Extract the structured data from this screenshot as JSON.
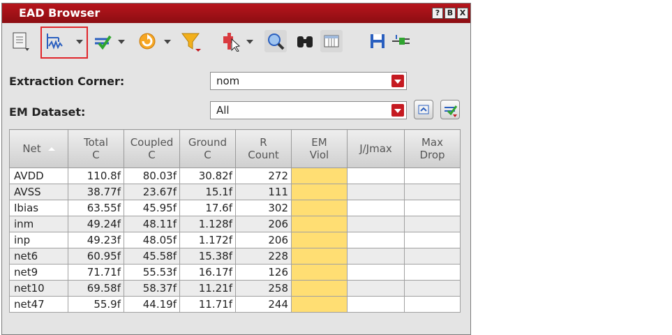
{
  "window": {
    "title": "EAD Browser",
    "title_buttons": [
      "?",
      "B",
      "X"
    ]
  },
  "toolbar": {
    "highlighted_item": "probe-tool-icon"
  },
  "extraction": {
    "label": "Extraction Corner:",
    "value": "nom"
  },
  "dataset": {
    "label": "EM Dataset:",
    "value": "All"
  },
  "table": {
    "headers": [
      {
        "l1": "Net",
        "l2": ""
      },
      {
        "l1": "Total",
        "l2": "C"
      },
      {
        "l1": "Coupled",
        "l2": "C"
      },
      {
        "l1": "Ground",
        "l2": "C"
      },
      {
        "l1": "R",
        "l2": "Count"
      },
      {
        "l1": "EM",
        "l2": "Viol"
      },
      {
        "l1": "J/Jmax",
        "l2": ""
      },
      {
        "l1": "Max",
        "l2": "Drop"
      }
    ],
    "rows": [
      {
        "net": "AVDD",
        "total": "110.8f",
        "coupled": "80.03f",
        "ground": "30.82f",
        "rcount": "272"
      },
      {
        "net": "AVSS",
        "total": "38.77f",
        "coupled": "23.67f",
        "ground": "15.1f",
        "rcount": "111"
      },
      {
        "net": "Ibias",
        "total": "63.55f",
        "coupled": "45.95f",
        "ground": "17.6f",
        "rcount": "302"
      },
      {
        "net": "inm",
        "total": "49.24f",
        "coupled": "48.11f",
        "ground": "1.128f",
        "rcount": "206"
      },
      {
        "net": "inp",
        "total": "49.23f",
        "coupled": "48.05f",
        "ground": "1.172f",
        "rcount": "206"
      },
      {
        "net": "net6",
        "total": "60.95f",
        "coupled": "45.58f",
        "ground": "15.38f",
        "rcount": "228"
      },
      {
        "net": "net9",
        "total": "71.71f",
        "coupled": "55.53f",
        "ground": "16.17f",
        "rcount": "126"
      },
      {
        "net": "net10",
        "total": "69.58f",
        "coupled": "58.37f",
        "ground": "11.21f",
        "rcount": "258"
      },
      {
        "net": "net47",
        "total": "55.9f",
        "coupled": "44.19f",
        "ground": "11.71f",
        "rcount": "244"
      }
    ]
  },
  "colors": {
    "title_bar": "#a01218",
    "em_highlight": "#ffde73",
    "accent_red": "#c51a21"
  }
}
